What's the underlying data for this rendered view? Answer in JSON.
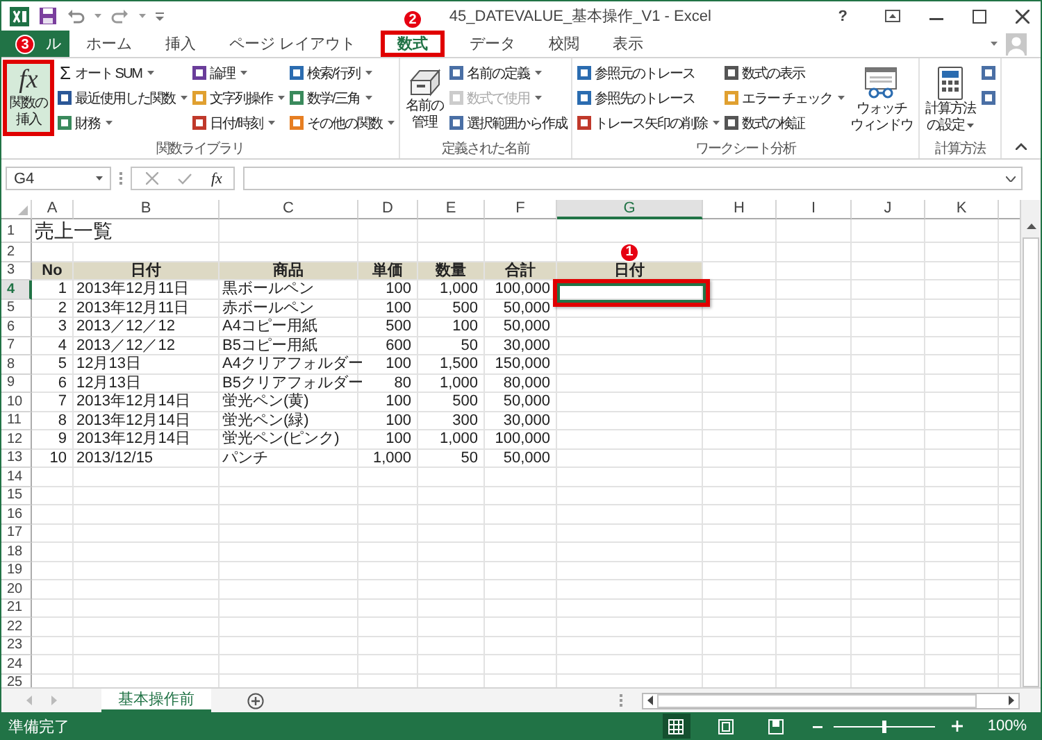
{
  "window": {
    "title": "45_DATEVALUE_基本操作_V1 - Excel",
    "help": "?"
  },
  "ribbon_tabs": [
    {
      "label": "ル",
      "kind": "file",
      "selected": false
    },
    {
      "label": "ホーム",
      "kind": "tab",
      "selected": false
    },
    {
      "label": "挿入",
      "kind": "tab",
      "selected": false
    },
    {
      "label": "ページ レイアウト",
      "kind": "tab",
      "selected": false
    },
    {
      "label": "数式",
      "kind": "tab",
      "selected": true,
      "callout": "2"
    },
    {
      "label": "データ",
      "kind": "tab",
      "selected": false
    },
    {
      "label": "校閲",
      "kind": "tab",
      "selected": false
    },
    {
      "label": "表示",
      "kind": "tab",
      "selected": false
    }
  ],
  "ribbon_groups": [
    {
      "name": "関数ライブラリ",
      "items": [
        {
          "kind": "large",
          "glyph": "fx",
          "lines": [
            "関数の",
            "挿入"
          ],
          "callout": "3",
          "dropdown": false
        },
        {
          "kind": "column",
          "items": [
            {
              "label": "オート SUM",
              "glyph": "Σ",
              "dropdown": true,
              "disabled": false
            },
            {
              "label": "最近使用した関数",
              "dropdown": true,
              "disabled": false
            },
            {
              "label": "財務",
              "dropdown": true,
              "disabled": false
            }
          ]
        },
        {
          "kind": "column",
          "items": [
            {
              "label": "論理",
              "dropdown": true,
              "disabled": false
            },
            {
              "label": "文字列操作",
              "dropdown": true,
              "disabled": false
            },
            {
              "label": "日付/時刻",
              "dropdown": true,
              "disabled": false
            }
          ]
        },
        {
          "kind": "column",
          "items": [
            {
              "label": "検索/行列",
              "dropdown": true,
              "disabled": false
            },
            {
              "label": "数学/三角",
              "dropdown": true,
              "disabled": false
            },
            {
              "label": "その他の関数",
              "dropdown": true,
              "disabled": false
            }
          ]
        }
      ]
    },
    {
      "name": "定義された名前",
      "items": [
        {
          "kind": "large",
          "lines": [
            "名前の",
            "管理"
          ],
          "dropdown": false
        },
        {
          "kind": "column",
          "items": [
            {
              "label": "名前の定義",
              "dropdown": true,
              "disabled": false
            },
            {
              "label": "数式で使用",
              "dropdown": true,
              "disabled": true
            },
            {
              "label": "選択範囲から作成",
              "dropdown": false,
              "disabled": false
            }
          ]
        }
      ]
    },
    {
      "name": "ワークシート分析",
      "items": [
        {
          "kind": "column",
          "items": [
            {
              "label": "参照元のトレース",
              "dropdown": false,
              "disabled": false
            },
            {
              "label": "参照先のトレース",
              "dropdown": false,
              "disabled": false
            },
            {
              "label": "トレース矢印の削除",
              "dropdown": true,
              "disabled": false
            }
          ]
        },
        {
          "kind": "column",
          "items": [
            {
              "label": "数式の表示",
              "dropdown": false,
              "disabled": false
            },
            {
              "label": "エラー チェック",
              "dropdown": true,
              "disabled": false
            },
            {
              "label": "数式の検証",
              "dropdown": false,
              "disabled": false
            }
          ]
        },
        {
          "kind": "large",
          "lines": [
            "ウォッチ",
            "ウィンドウ"
          ],
          "dropdown": false
        }
      ]
    },
    {
      "name": "計算方法",
      "items": [
        {
          "kind": "large",
          "lines": [
            "計算方法",
            "の設定"
          ],
          "dropdown": true
        },
        {
          "kind": "column",
          "items": [
            {
              "dropdown": false,
              "disabled": false
            },
            {
              "dropdown": false,
              "disabled": false
            }
          ]
        }
      ]
    }
  ],
  "formula_bar": {
    "name_box": "G4",
    "fx": "fx"
  },
  "columns": [
    {
      "label": "A",
      "selected": false
    },
    {
      "label": "B",
      "selected": false
    },
    {
      "label": "C",
      "selected": false
    },
    {
      "label": "D",
      "selected": false
    },
    {
      "label": "E",
      "selected": false
    },
    {
      "label": "F",
      "selected": false
    },
    {
      "label": "G",
      "selected": true
    },
    {
      "label": "H",
      "selected": false
    },
    {
      "label": "I",
      "selected": false
    },
    {
      "label": "J",
      "selected": false
    },
    {
      "label": "K",
      "selected": false
    }
  ],
  "rows": [
    {
      "num": "1",
      "kind": "title",
      "selected": false,
      "cells": [
        "売上一覧"
      ]
    },
    {
      "num": "2",
      "kind": "data",
      "selected": false,
      "cells": []
    },
    {
      "num": "3",
      "kind": "header",
      "selected": false,
      "cells": [
        "No",
        "日付",
        "商品",
        "単価",
        "数量",
        "合計",
        "日付"
      ]
    },
    {
      "num": "4",
      "kind": "data",
      "selected": true,
      "cells": [
        "1",
        "2013年12月11日",
        "黒ボールペン",
        "100",
        "1,000",
        "100,000"
      ]
    },
    {
      "num": "5",
      "kind": "data",
      "selected": false,
      "cells": [
        "2",
        "2013年12月11日",
        "赤ボールペン",
        "100",
        "500",
        "50,000"
      ]
    },
    {
      "num": "6",
      "kind": "data",
      "selected": false,
      "cells": [
        "3",
        "2013／12／12",
        "A4コピー用紙",
        "500",
        "100",
        "50,000"
      ]
    },
    {
      "num": "7",
      "kind": "data",
      "selected": false,
      "cells": [
        "4",
        "2013／12／12",
        "B5コピー用紙",
        "600",
        "50",
        "30,000"
      ]
    },
    {
      "num": "8",
      "kind": "data",
      "selected": false,
      "cells": [
        "5",
        "12月13日",
        "A4クリアフォルダー",
        "100",
        "1,500",
        "150,000"
      ]
    },
    {
      "num": "9",
      "kind": "data",
      "selected": false,
      "cells": [
        "6",
        "12月13日",
        "B5クリアフォルダー",
        "80",
        "1,000",
        "80,000"
      ]
    },
    {
      "num": "10",
      "kind": "data",
      "selected": false,
      "cells": [
        "7",
        "2013年12月14日",
        "蛍光ペン(黄)",
        "100",
        "500",
        "50,000"
      ]
    },
    {
      "num": "11",
      "kind": "data",
      "selected": false,
      "cells": [
        "8",
        "2013年12月14日",
        "蛍光ペン(緑)",
        "100",
        "300",
        "30,000"
      ]
    },
    {
      "num": "12",
      "kind": "data",
      "selected": false,
      "cells": [
        "9",
        "2013年12月14日",
        "蛍光ペン(ピンク)",
        "100",
        "1,000",
        "100,000"
      ]
    },
    {
      "num": "13",
      "kind": "data",
      "selected": false,
      "cells": [
        "10",
        "2013/12/15",
        "パンチ",
        "1,000",
        "50",
        "50,000"
      ]
    },
    {
      "num": "14",
      "kind": "data",
      "selected": false,
      "cells": []
    },
    {
      "num": "15",
      "kind": "data",
      "selected": false,
      "cells": []
    },
    {
      "num": "16",
      "kind": "data",
      "selected": false,
      "cells": []
    },
    {
      "num": "17",
      "kind": "data",
      "selected": false,
      "cells": []
    },
    {
      "num": "18",
      "kind": "data",
      "selected": false,
      "cells": []
    },
    {
      "num": "19",
      "kind": "data",
      "selected": false,
      "cells": []
    },
    {
      "num": "20",
      "kind": "data",
      "selected": false,
      "cells": []
    },
    {
      "num": "21",
      "kind": "data",
      "selected": false,
      "cells": []
    },
    {
      "num": "22",
      "kind": "data",
      "selected": false,
      "cells": []
    },
    {
      "num": "23",
      "kind": "data",
      "selected": false,
      "cells": []
    },
    {
      "num": "24",
      "kind": "data",
      "selected": false,
      "cells": []
    },
    {
      "num": "25",
      "kind": "data",
      "selected": false,
      "cells": []
    }
  ],
  "active_cell_callout": "1",
  "sheet_tabs": [
    {
      "label": "基本操作前",
      "selected": true
    }
  ],
  "status": {
    "text": "準備完了",
    "views": [
      {
        "selected": true
      },
      {
        "selected": false
      },
      {
        "selected": false
      }
    ],
    "zoom": "100%",
    "zoom_slider": {
      "level": 0.5
    }
  }
}
